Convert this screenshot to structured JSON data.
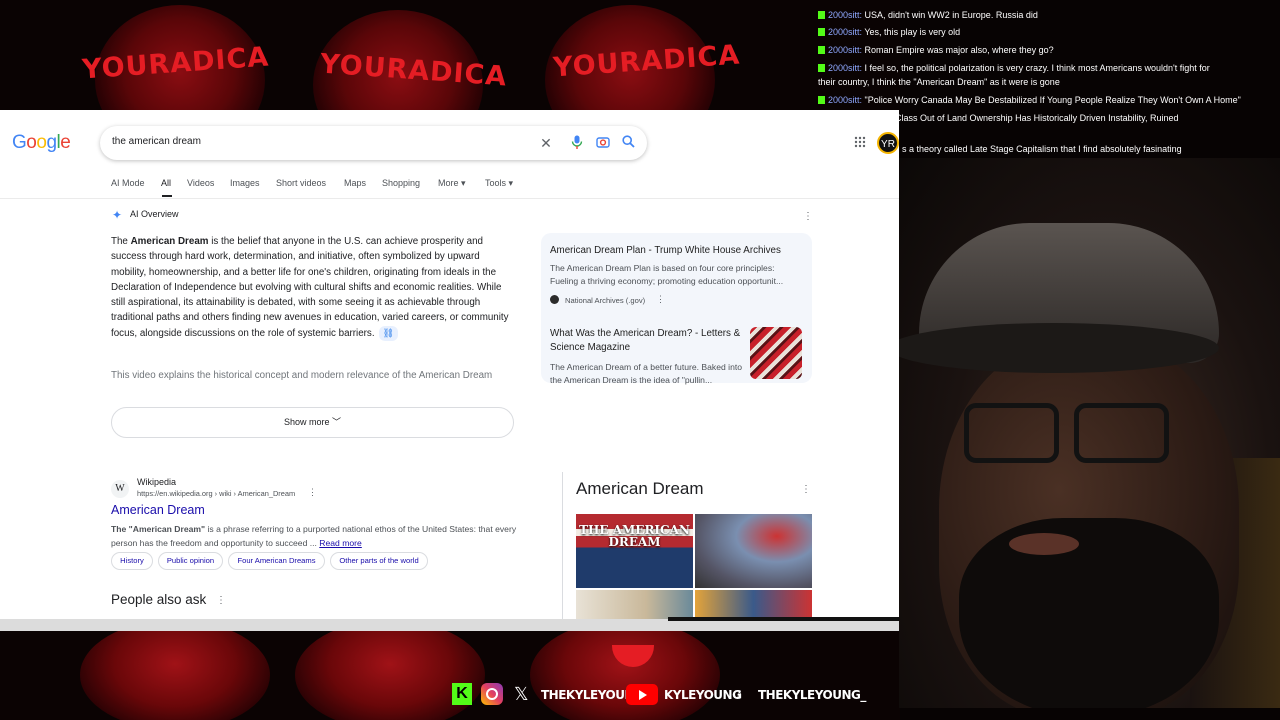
{
  "overlay": {
    "logo_text": "YOURADICA"
  },
  "chat": [
    {
      "user": "2000sitt:",
      "text": "USA, didn't win WW2 in Europe. Russia did"
    },
    {
      "user": "2000sitt:",
      "text": "Yes, this play is very old"
    },
    {
      "user": "2000sitt:",
      "text": "Roman Empire was major also, where they go?"
    },
    {
      "user": "2000sitt:",
      "text": "I feel so, the political polarization is very crazy. I think most Americans wouldn't fight for"
    },
    {
      "user": "",
      "text": "their country, I think the \"American Dream\" as it were is gone"
    },
    {
      "user": "2000sitt:",
      "text": "\"Police Worry Canada May Be Destabilized If Young People Realize They Won't Own A Home\""
    },
    {
      "user": "",
      "text": "g A Class Out of Land Ownership Has Historically Driven Instability, Ruined"
    },
    {
      "user": "",
      "text": "s a theory called Late Stage Capitalism that I find absolutely fasinating"
    }
  ],
  "google": {
    "logo": [
      "G",
      "o",
      "o",
      "g",
      "l",
      "e"
    ],
    "logo_colors": [
      "#4285f4",
      "#ea4335",
      "#fbbc05",
      "#4285f4",
      "#34a853",
      "#ea4335"
    ],
    "query": "the american dream",
    "avatar": "YR",
    "tabs": [
      "AI Mode",
      "All",
      "Videos",
      "Images",
      "Short videos",
      "Maps",
      "Shopping",
      "More ▾",
      "Tools ▾"
    ],
    "ai_overview": {
      "label": "AI Overview",
      "intro": "The ",
      "bold": "American Dream",
      "body": " is the belief that anyone in the U.S. can achieve prosperity and success through hard work, determination, and initiative, often symbolized by upward mobility, homeownership, and a better life for one's children, originating from ideals in the Declaration of Independence but evolving with cultural shifts and economic realities. While still aspirational, its attainability is debated, with some seeing it as achievable through traditional paths and others finding new avenues in education, varied careers, or community focus, alongside discussions on the role of systemic barriers.",
      "fade": "This video explains the historical concept and modern relevance of the American Dream",
      "show_more": "Show more"
    },
    "sources": [
      {
        "title": "American Dream Plan - Trump White House Archives",
        "desc": "The American Dream Plan is based on four core principles: Fueling a thriving economy; promoting education opportunit...",
        "site": "National Archives (.gov)"
      },
      {
        "title": "What Was the American Dream? - Letters & Science Magazine",
        "desc": "The American Dream of a better future. Baked into the American Dream is the idea of \"pullin..."
      }
    ],
    "result": {
      "favicon": "W",
      "site": "Wikipedia",
      "url": "https://en.wikipedia.org › wiki › American_Dream",
      "title": "American Dream",
      "snippet_bold": "The \"American Dream\"",
      "snippet": " is a phrase referring to a purported national ethos of the United States: that every person has the freedom and opportunity to succeed ...",
      "read_more": "Read more",
      "chips": [
        "History",
        "Public opinion",
        "Four American Dreams",
        "Other parts of the world"
      ]
    },
    "people_also_ask": "People also ask",
    "knowledge_panel": {
      "title": "American Dream",
      "image_caption": "THE AMERICAN DREAM"
    }
  },
  "socials": {
    "x_handle": "THEKYLEYOUNG",
    "youtube_handle": "KYLEYOUNG",
    "tiktok_handle": "THEKYLEYOUNG_"
  }
}
